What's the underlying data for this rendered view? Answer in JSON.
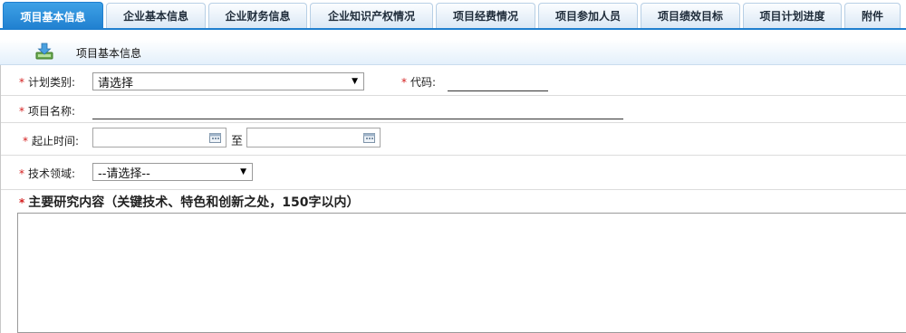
{
  "tabs": [
    {
      "label": "项目基本信息",
      "active": true
    },
    {
      "label": "企业基本信息",
      "active": false
    },
    {
      "label": "企业财务信息",
      "active": false
    },
    {
      "label": "企业知识产权情况",
      "active": false
    },
    {
      "label": "项目经费情况",
      "active": false
    },
    {
      "label": "项目参加人员",
      "active": false
    },
    {
      "label": "项目绩效目标",
      "active": false
    },
    {
      "label": "项目计划进度",
      "active": false
    },
    {
      "label": "附件",
      "active": false
    }
  ],
  "section": {
    "title": "项目基本信息",
    "icon": "download-icon"
  },
  "form": {
    "required_mark": "*",
    "plan_type": {
      "label": "计划类别:",
      "selected": "请选择"
    },
    "code": {
      "label": "代码:",
      "value": ""
    },
    "project_name": {
      "label": "项目名称:",
      "value": ""
    },
    "period": {
      "label": "起止时间:",
      "start": "",
      "separator": "至",
      "end": ""
    },
    "tech_field": {
      "label": "技术领域:",
      "selected": "--请选择--"
    },
    "research_content": {
      "label": "主要研究内容（关键技术、特色和创新之处，150字以内）",
      "value": ""
    }
  },
  "colors": {
    "accent": "#1f7fcf",
    "required": "#d42020"
  }
}
